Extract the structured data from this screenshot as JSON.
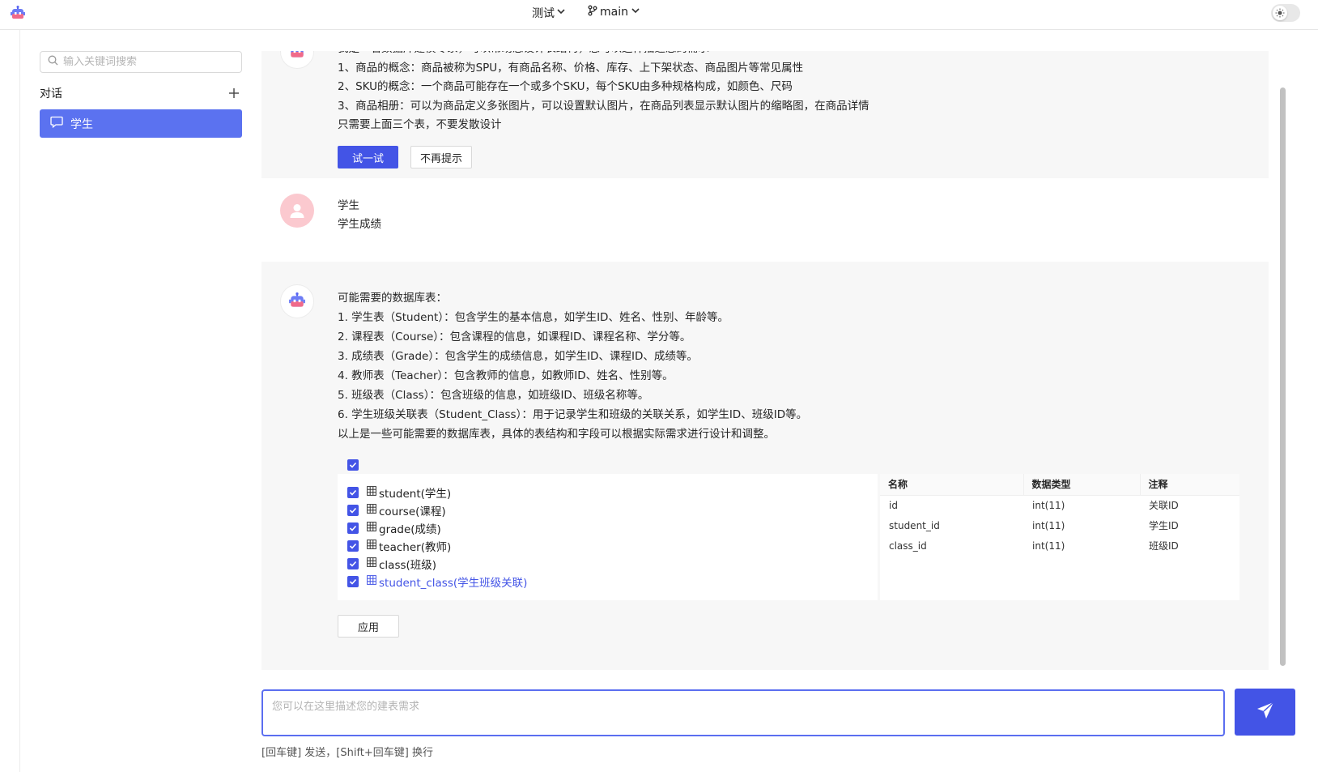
{
  "topbar": {
    "project": "测试",
    "branch": "main"
  },
  "sidebar": {
    "search_placeholder": "输入关键词搜索",
    "section_title": "对话",
    "conversations": [
      {
        "label": "学生"
      }
    ]
  },
  "messages": {
    "tip": {
      "partial_line": "我是一名数据库建模专家，可以帮助您设计表结构，您可以这样描述您的需求",
      "lines": [
        "1、商品的概念：商品被称为SPU，有商品名称、价格、库存、上下架状态、商品图片等常见属性",
        "2、SKU的概念：一个商品可能存在一个或多个SKU，每个SKU由多种规格构成，如颜色、尺码",
        "3、商品相册：可以为商品定义多张图片，可以设置默认图片，在商品列表显示默认图片的缩略图，在商品详情",
        "只需要上面三个表，不要发散设计"
      ],
      "try_button": "试一试",
      "dismiss_button": "不再提示"
    },
    "user": {
      "lines": [
        "学生",
        "学生成绩"
      ]
    },
    "reply": {
      "lines": [
        "可能需要的数据库表：",
        "1. 学生表（Student）：包含学生的基本信息，如学生ID、姓名、性别、年龄等。",
        "2. 课程表（Course）：包含课程的信息，如课程ID、课程名称、学分等。",
        "3. 成绩表（Grade）：包含学生的成绩信息，如学生ID、课程ID、成绩等。",
        "4. 教师表（Teacher）：包含教师的信息，如教师ID、姓名、性别等。",
        "5. 班级表（Class）：包含班级的信息，如班级ID、班级名称等。",
        "6. 学生班级关联表（Student_Class）：用于记录学生和班级的关联关系，如学生ID、班级ID等。",
        "以上是一些可能需要的数据库表，具体的表结构和字段可以根据实际需求进行设计和调整。"
      ],
      "tables": [
        {
          "label": "student(学生)",
          "checked": true
        },
        {
          "label": "course(课程)",
          "checked": true
        },
        {
          "label": "grade(成绩)",
          "checked": true
        },
        {
          "label": "teacher(教师)",
          "checked": true
        },
        {
          "label": "class(班级)",
          "checked": true
        },
        {
          "label": "student_class(学生班级关联)",
          "checked": true
        }
      ],
      "field_headers": [
        "名称",
        "数据类型",
        "注释"
      ],
      "fields": [
        {
          "name": "id",
          "type": "int(11)",
          "comment": "关联ID"
        },
        {
          "name": "student_id",
          "type": "int(11)",
          "comment": "学生ID"
        },
        {
          "name": "class_id",
          "type": "int(11)",
          "comment": "班级ID"
        }
      ],
      "apply_button": "应用"
    }
  },
  "composer": {
    "placeholder": "您可以在这里描述您的建表需求",
    "hint": "[回车键] 发送，[Shift+回车键] 换行"
  },
  "colors": {
    "accent": "#4354e6",
    "selected_conversation": "#5b72f0",
    "user_avatar": "#fbc9cf"
  }
}
